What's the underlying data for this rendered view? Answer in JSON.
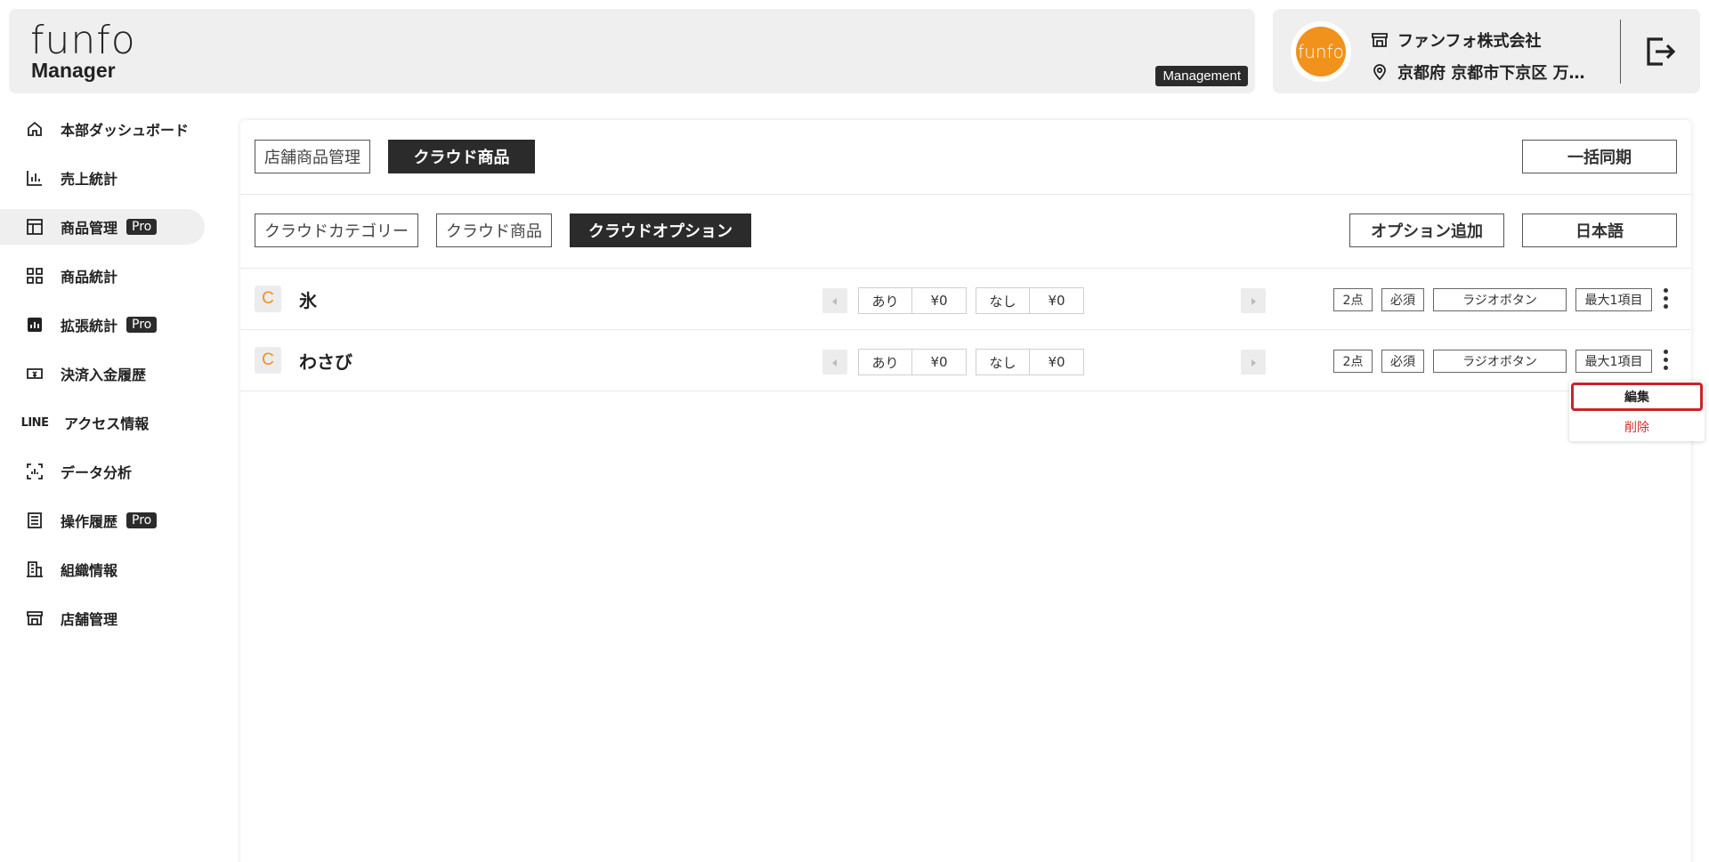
{
  "header": {
    "logo_main": "funfo",
    "logo_sub": "Manager",
    "mode_badge": "Management",
    "avatar_text": "funfo",
    "company_name": "ファンフォ株式会社",
    "address": "京都府 京都市下京区 万…"
  },
  "sidebar": {
    "items": [
      {
        "label": "本部ダッシュボード",
        "icon": "home-icon",
        "pro": ""
      },
      {
        "label": "売上統計",
        "icon": "bar-chart-icon",
        "pro": ""
      },
      {
        "label": "商品管理",
        "icon": "layout-icon",
        "pro": "Pro",
        "active": true
      },
      {
        "label": "商品統計",
        "icon": "grid-icon",
        "pro": ""
      },
      {
        "label": "拡張統計",
        "icon": "analytics-icon",
        "pro": "Pro"
      },
      {
        "label": "決済入金履歴",
        "icon": "payment-icon",
        "pro": ""
      },
      {
        "label": "アクセス情報",
        "icon": "line-logo-icon",
        "icon_text": "LINE",
        "pro": ""
      },
      {
        "label": "データ分析",
        "icon": "scan-chart-icon",
        "pro": ""
      },
      {
        "label": "操作履歴",
        "icon": "list-icon",
        "pro": "Pro"
      },
      {
        "label": "組織情報",
        "icon": "building-icon",
        "pro": ""
      },
      {
        "label": "店舗管理",
        "icon": "store-icon",
        "pro": ""
      }
    ]
  },
  "tabs_top": {
    "store_products": "店舗商品管理",
    "cloud_products": "クラウド商品",
    "bulk_sync": "一括同期"
  },
  "tabs_sub": {
    "cloud_category": "クラウドカテゴリー",
    "cloud_products": "クラウド商品",
    "cloud_options": "クラウドオプション",
    "add_option": "オプション追加",
    "language": "日本語"
  },
  "options": [
    {
      "badge": "C",
      "name": "氷",
      "choices": [
        {
          "label": "あり",
          "price": "¥0"
        },
        {
          "label": "なし",
          "price": "¥0"
        }
      ],
      "count": "2点",
      "required": "必須",
      "type": "ラジオボタン",
      "max": "最大1項目"
    },
    {
      "badge": "C",
      "name": "わさび",
      "choices": [
        {
          "label": "あり",
          "price": "¥0"
        },
        {
          "label": "なし",
          "price": "¥0"
        }
      ],
      "count": "2点",
      "required": "必須",
      "type": "ラジオボタン",
      "max": "最大1項目"
    }
  ],
  "menu": {
    "edit": "編集",
    "delete": "削除"
  },
  "colors": {
    "accent_orange": "#f0921b",
    "dark": "#2b2b2b",
    "danger": "#d0302a"
  }
}
